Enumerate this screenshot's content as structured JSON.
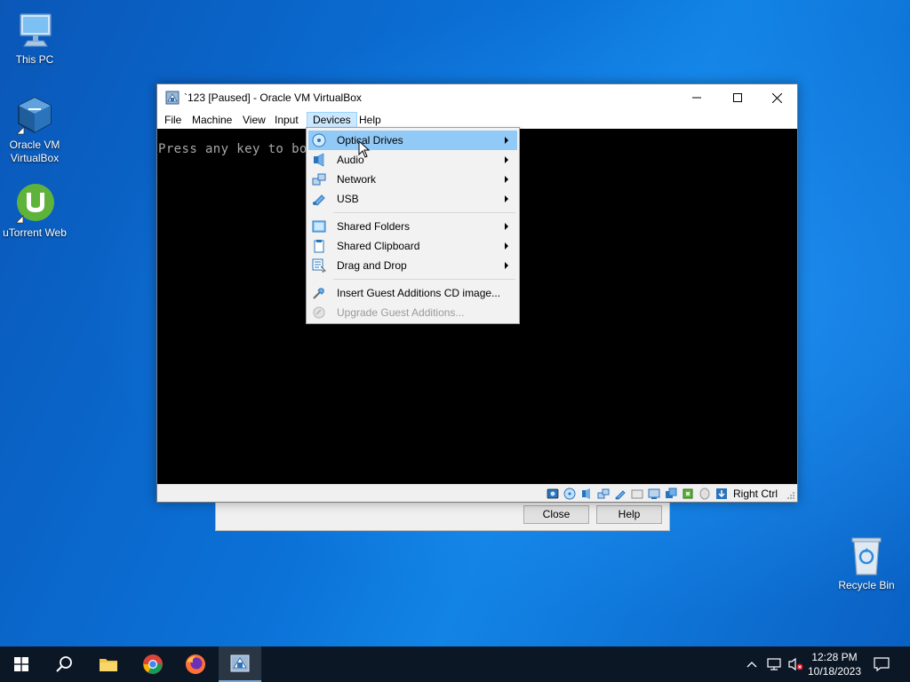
{
  "desktop": {
    "icons": [
      {
        "label": "This PC",
        "icon": "monitor-icon"
      },
      {
        "label": "Oracle VM VirtualBox",
        "icon": "virtualbox-icon"
      },
      {
        "label": "uTorrent Web",
        "icon": "utorrent-icon"
      },
      {
        "label": "Recycle Bin",
        "icon": "recycle-bin-icon"
      }
    ]
  },
  "background_dialog": {
    "close_label": "Close",
    "help_label": "Help"
  },
  "window": {
    "title": "`123 [Paused] - Oracle VM VirtualBox",
    "menu": [
      "File",
      "Machine",
      "View",
      "Input",
      "Devices",
      "Help"
    ],
    "active_menu": "Devices",
    "console_text": "Press any key to bo",
    "host_key": "Right Ctrl"
  },
  "devices_menu": {
    "items": [
      {
        "label": "Optical Drives",
        "icon": "optical-disc-icon",
        "submenu": true,
        "highlighted": true
      },
      {
        "label": "Audio",
        "icon": "audio-icon",
        "submenu": true
      },
      {
        "label": "Network",
        "icon": "network-icon",
        "submenu": true
      },
      {
        "label": "USB",
        "icon": "usb-icon",
        "submenu": true
      },
      {
        "label": "Shared Folders",
        "icon": "shared-folders-icon",
        "submenu": true
      },
      {
        "label": "Shared Clipboard",
        "icon": "clipboard-icon",
        "submenu": true
      },
      {
        "label": "Drag and Drop",
        "icon": "drag-drop-icon",
        "submenu": true
      },
      {
        "label": "Insert Guest Additions CD image...",
        "icon": "guest-additions-icon",
        "submenu": false
      },
      {
        "label": "Upgrade Guest Additions...",
        "icon": "upgrade-icon",
        "submenu": false,
        "disabled": true
      }
    ]
  },
  "taskbar": {
    "clock_time": "12:28 PM",
    "clock_date": "10/18/2023"
  },
  "colors": {
    "menu_highlight": "#91c9f7",
    "active_menu_bg": "#cce8ff",
    "taskbar": "#0c1726"
  }
}
